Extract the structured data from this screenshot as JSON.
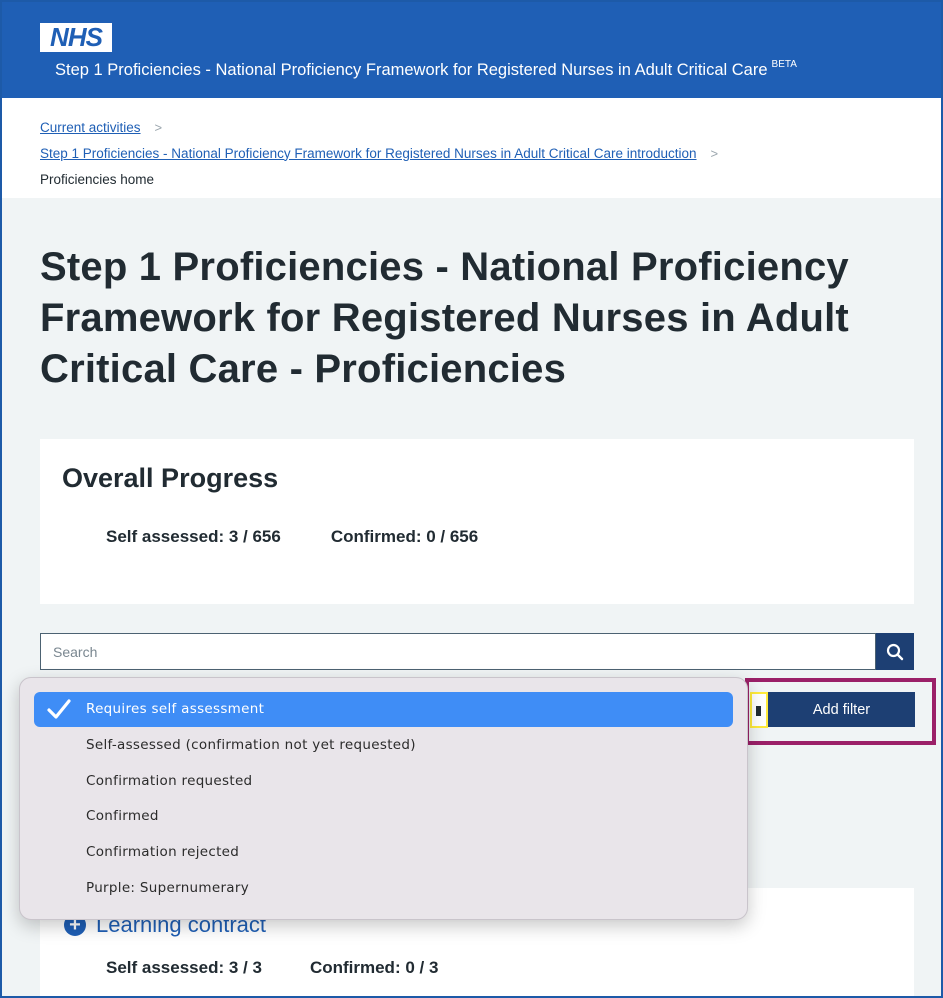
{
  "header": {
    "logo_text": "NHS",
    "title": "Step 1 Proficiencies - National Proficiency Framework for Registered Nurses in Adult Critical Care",
    "badge": "BETA"
  },
  "breadcrumb": {
    "items": [
      {
        "label": "Current activities"
      },
      {
        "label": "Step 1 Proficiencies - National Proficiency Framework for Registered Nurses in Adult Critical Care introduction"
      },
      {
        "label": "Proficiencies home"
      }
    ],
    "separator": ">"
  },
  "page": {
    "title": "Step 1 Proficiencies - National Proficiency Framework for Registered Nurses in Adult Critical Care - Proficiencies"
  },
  "progress": {
    "heading": "Overall Progress",
    "self_assessed": "Self assessed: 3 / 656",
    "confirmed": "Confirmed: 0 / 656"
  },
  "search": {
    "placeholder": "Search"
  },
  "filter": {
    "add_label": "Add filter",
    "options": [
      {
        "label": "Requires self assessment",
        "selected": true
      },
      {
        "label": "Self-assessed (confirmation not yet requested)",
        "selected": false
      },
      {
        "label": "Confirmation requested",
        "selected": false
      },
      {
        "label": "Confirmed",
        "selected": false
      },
      {
        "label": "Confirmation rejected",
        "selected": false
      },
      {
        "label": "Purple: Supernumerary",
        "selected": false
      }
    ]
  },
  "sections": [
    {
      "title": "Learning contract",
      "self_assessed": "Self assessed: 3 / 3",
      "confirmed": "Confirmed: 0 / 3"
    }
  ],
  "colors": {
    "header_blue": "#1f5fb5",
    "button_navy": "#1d3f73",
    "highlight": "#9b2068",
    "selected_option": "#3f8df6"
  }
}
